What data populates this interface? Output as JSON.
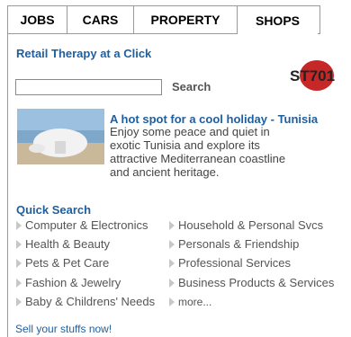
{
  "tabs": [
    {
      "label": "JOBS"
    },
    {
      "label": "CARS"
    },
    {
      "label": "PROPERTY"
    },
    {
      "label": "SHOPS"
    }
  ],
  "promo": {
    "title": "Retail Therapy at a Click"
  },
  "logo": {
    "text": "ST701",
    "accent_color": "#c62828"
  },
  "search": {
    "value": "",
    "button_label": "Search"
  },
  "feature": {
    "title": "A hot spot for a cool holiday - Tunisia",
    "description": "Enjoy some peace and quiet in exotic Tunisia and explore its attractive Mediterranean coastline and ancient heritage."
  },
  "quick_search": {
    "title": "Quick Search",
    "left": [
      "Computer & Electronics",
      "Health & Beauty",
      "Pets & Pet Care",
      "Fashion & Jewelry",
      "Baby & Childrens' Needs"
    ],
    "right": [
      "Household & Personal Svcs",
      "Personals & Friendship",
      "Professional Services",
      "Business Products & Services",
      "more..."
    ]
  },
  "sell": {
    "label": "Sell your stuffs now!"
  },
  "colors": {
    "link": "#1f5fa0",
    "border": "#9a9a9a"
  }
}
